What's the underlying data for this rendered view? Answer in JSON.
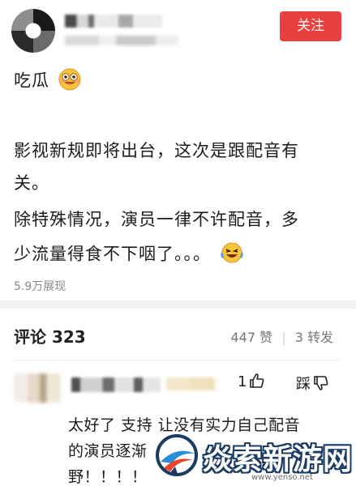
{
  "header": {
    "follow_label": "关注"
  },
  "post": {
    "lines": [
      "吃瓜",
      "影视新规即将出台，这次是跟配音有",
      "关。",
      "除特殊情况，演员一律不许配音，多",
      "少流量得食不下咽了。。。"
    ],
    "emoji_1": "grinning-tongue-emoji",
    "emoji_2": "laughing-tears-emoji",
    "views": "5.9万展现"
  },
  "comments_header": {
    "title": "评论 323",
    "likes": "447 赞",
    "shares": "3 转发"
  },
  "comment": {
    "like_count": "1",
    "dislike_label": "踩",
    "lines": [
      "太好了 支持 让没有实力自己配音",
      "的演员逐渐",
      "野！！！！"
    ]
  },
  "watermark": {
    "brand": "焱索新游网",
    "url": "www.yenso.net"
  },
  "colors": {
    "follow_bg": "#e9403d",
    "watermark_outline": "#1b3b63"
  }
}
